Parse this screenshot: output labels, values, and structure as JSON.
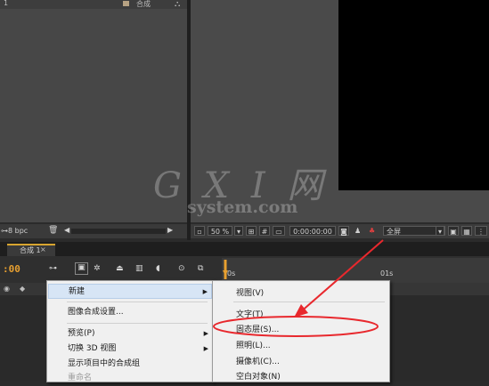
{
  "project_panel": {
    "row_number": "1",
    "row_name": "合成",
    "bpc_label": "8 bpc"
  },
  "viewer_bar": {
    "zoom": "50 %",
    "timecode": "0:00:00:00",
    "resolution": "全屏"
  },
  "timeline": {
    "tab_label": "合成 1",
    "tab_close": "×",
    "timecode": ":00",
    "ruler_start": "0s",
    "ruler_mark": "01s"
  },
  "context_menu": {
    "items": [
      {
        "label": "新建",
        "has_submenu": true,
        "highlighted": true
      },
      {
        "label": "图像合成设置...",
        "has_submenu": false
      },
      {
        "label": "预览(P)",
        "has_submenu": true
      },
      {
        "label": "切换 3D 视图",
        "has_submenu": true
      },
      {
        "label": "显示项目中的合成组",
        "has_submenu": false
      },
      {
        "label": "重命名",
        "has_submenu": false,
        "disabled": true
      }
    ]
  },
  "submenu": {
    "items": [
      {
        "label": "视图(V)"
      },
      {
        "label": "文字(T)"
      },
      {
        "label": "固态层(S)..."
      },
      {
        "label": "照明(L)..."
      },
      {
        "label": "摄像机(C)..."
      },
      {
        "label": "空白对象(N)"
      }
    ]
  },
  "watermark": {
    "main": "G X I 网",
    "sub": "system.com"
  },
  "colors": {
    "accent_timecode": "#e8a030",
    "annotation_red": "#e8282d",
    "menu_highlight": "#d7e5f5"
  }
}
